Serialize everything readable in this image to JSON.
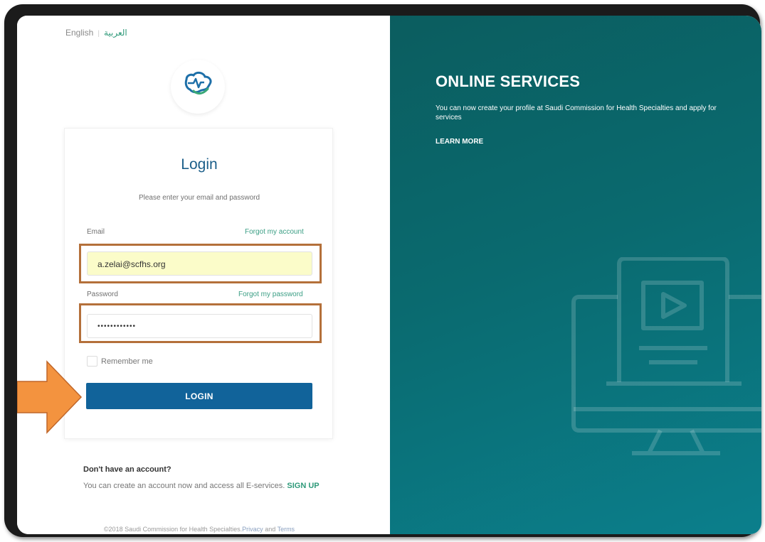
{
  "language": {
    "english": "English",
    "separator": "|",
    "arabic": "العربية"
  },
  "login": {
    "title": "Login",
    "subtitle": "Please enter your email and password",
    "email_label": "Email",
    "email_value": "a.zelai@scfhs.org",
    "forgot_account": "Forgot my account",
    "password_label": "Password",
    "password_value": "••••••••••••",
    "forgot_password": "Forgot my password",
    "remember_me": "Remember me",
    "button": "LOGIN"
  },
  "signup": {
    "heading": "Don't have an account?",
    "text": "You can create an account now and access all E-services.",
    "link": "SIGN UP"
  },
  "footer": {
    "copyright": "©2018 Saudi Commission for Health Specialties.",
    "privacy": "Privacy",
    "and": "and",
    "terms": "Terms"
  },
  "promo": {
    "title": "ONLINE SERVICES",
    "text": "You can now create your profile at Saudi Commission for Health Specialties and apply for services",
    "learn_more": "LEARN MORE"
  },
  "icons": {
    "logo": "scfhs-logo-icon",
    "arrow": "arrow-right-icon",
    "illustration": "computer-video-icon"
  },
  "colors": {
    "primary_button": "#11639a",
    "accent_green": "#2f9a7a",
    "panel_teal": "#0a6a6f",
    "highlight_box": "#b4703a",
    "arrow": "#f3933f"
  }
}
